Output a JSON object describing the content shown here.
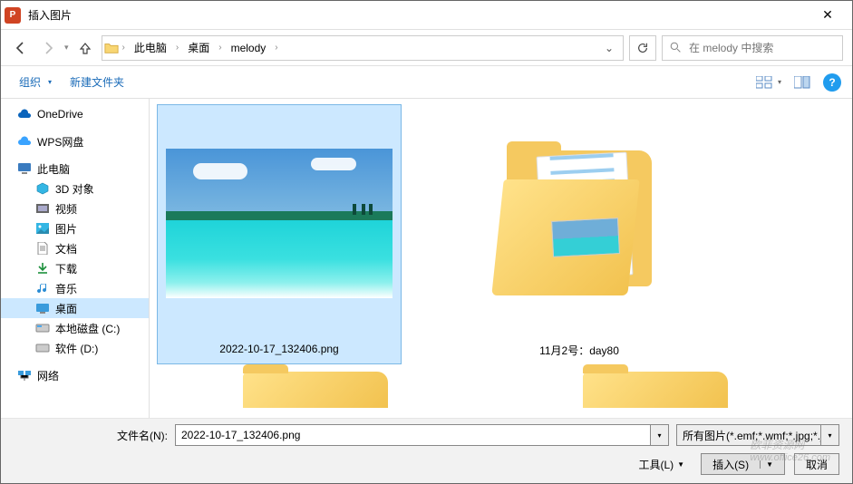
{
  "dialog": {
    "title": "插入图片"
  },
  "nav": {
    "breadcrumb": [
      "此电脑",
      "桌面",
      "melody"
    ],
    "search_placeholder": "在 melody 中搜索"
  },
  "toolbar": {
    "organize": "组织",
    "new_folder": "新建文件夹"
  },
  "sidebar": {
    "items": [
      {
        "label": "OneDrive",
        "kind": "cloud",
        "level": 0
      },
      {
        "label": "WPS网盘",
        "kind": "wps",
        "level": 0
      },
      {
        "label": "此电脑",
        "kind": "pc",
        "level": 0
      },
      {
        "label": "3D 对象",
        "kind": "3d",
        "level": 1
      },
      {
        "label": "视频",
        "kind": "video",
        "level": 1
      },
      {
        "label": "图片",
        "kind": "pictures",
        "level": 1
      },
      {
        "label": "文档",
        "kind": "docs",
        "level": 1
      },
      {
        "label": "下载",
        "kind": "downloads",
        "level": 1
      },
      {
        "label": "音乐",
        "kind": "music",
        "level": 1
      },
      {
        "label": "桌面",
        "kind": "desktop",
        "level": 1,
        "selected": true
      },
      {
        "label": "本地磁盘 (C:)",
        "kind": "disk",
        "level": 1
      },
      {
        "label": "软件 (D:)",
        "kind": "disk",
        "level": 1
      },
      {
        "label": "网络",
        "kind": "network",
        "level": 0
      }
    ]
  },
  "files": [
    {
      "name": "2022-10-17_132406.png",
      "type": "image",
      "selected": true
    },
    {
      "name": "11月2号：day80",
      "type": "folder",
      "selected": false
    }
  ],
  "footer": {
    "filename_label": "文件名(N):",
    "filename_value": "2022-10-17_132406.png",
    "filetype_value": "所有图片(*.emf;*.wmf;*.jpg;*.j",
    "tools": "工具(L)",
    "insert": "插入(S)",
    "cancel": "取消"
  },
  "watermark": {
    "line1": "欧菲资源网",
    "line2": "www.office26.com"
  }
}
